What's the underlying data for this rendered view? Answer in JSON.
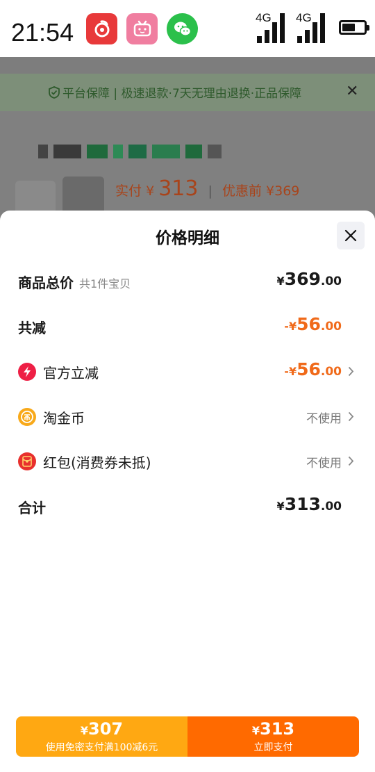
{
  "status_bar": {
    "time": "21:54",
    "apps": [
      "netease-music-icon",
      "bilibili-icon",
      "wechat-icon"
    ],
    "signal_labels": [
      "4G",
      "4G"
    ],
    "battery_level": 0.6
  },
  "background_page": {
    "guarantee_text": "平台保障 | 极速退款·7天无理由退换·正品保障",
    "price_label": "实付",
    "price_currency": "¥",
    "price_value": "313",
    "original_label": "优惠前",
    "original_value": "¥369"
  },
  "sheet": {
    "title": "价格明细",
    "rows": [
      {
        "label": "商品总价",
        "note": "共1件宝贝",
        "currency": "¥",
        "int": "369",
        "dec": ".00"
      },
      {
        "label": "共减",
        "prefix": "-",
        "currency": "¥",
        "int": "56",
        "dec": ".00"
      },
      {
        "label": "官方立减",
        "icon": "lightning-icon",
        "prefix": "-",
        "currency": "¥",
        "int": "56",
        "dec": ".00"
      },
      {
        "label": "淘金币",
        "icon": "gold-coin-icon",
        "status": "不使用"
      },
      {
        "label": "红包(消费券未抵)",
        "icon": "red-packet-icon",
        "status": "不使用"
      },
      {
        "label": "合计",
        "currency": "¥",
        "int": "313",
        "dec": ".00"
      }
    ]
  },
  "pay": {
    "left": {
      "currency": "¥",
      "amount": "307",
      "subtitle": "使用免密支付满100减6元"
    },
    "right": {
      "currency": "¥",
      "amount": "313",
      "subtitle": "立即支付"
    }
  },
  "colors": {
    "accent_orange": "#f06a1a",
    "pay_left": "#ffa812",
    "pay_right": "#ff6a00"
  }
}
